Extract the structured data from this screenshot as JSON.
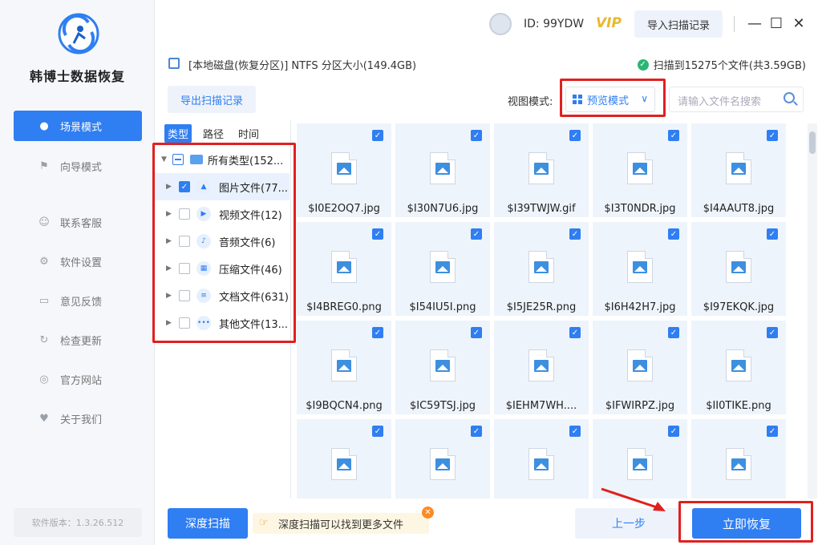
{
  "app": {
    "name": "韩博士数据恢复",
    "version_label": "软件版本：1.3.26.512"
  },
  "user": {
    "id_label": "ID: 99YDW",
    "vip_label": "VIP"
  },
  "header": {
    "import_label": "导入扫描记录",
    "window_controls": [
      "minimize-icon",
      "maximize-icon",
      "close-icon"
    ]
  },
  "sidebar": {
    "items": [
      {
        "label": "场景模式",
        "icon": "scene-icon",
        "active": true
      },
      {
        "label": "向导模式",
        "icon": "flag-icon"
      },
      {
        "label": "联系客服",
        "icon": "support-icon"
      },
      {
        "label": "软件设置",
        "icon": "gear-icon"
      },
      {
        "label": "意见反馈",
        "icon": "feedback-icon"
      },
      {
        "label": "检查更新",
        "icon": "update-icon"
      },
      {
        "label": "官方网站",
        "icon": "globe-icon"
      },
      {
        "label": "关于我们",
        "icon": "about-icon"
      }
    ]
  },
  "pathbar": {
    "path": "[本地磁盘(恢复分区)] NTFS 分区大小(149.4GB)",
    "scan_result": "扫描到15275个文件(共3.59GB)"
  },
  "toolbar": {
    "export_label": "导出扫描记录",
    "view_mode_label": "视图模式:",
    "view_mode_value": "预览模式",
    "search_placeholder": "请输入文件名搜索"
  },
  "tree": {
    "tabs": [
      "类型",
      "路径",
      "时间"
    ],
    "root": {
      "label": "所有类型(152..."
    },
    "children": [
      {
        "label": "图片文件(77...",
        "checked": true,
        "icon": "image-icon",
        "glyph": "▲"
      },
      {
        "label": "视频文件(12)",
        "checked": false,
        "icon": "video-icon",
        "glyph": "▶"
      },
      {
        "label": "音频文件(6)",
        "checked": false,
        "icon": "audio-icon",
        "glyph": "♪"
      },
      {
        "label": "压缩文件(46)",
        "checked": false,
        "icon": "archive-icon",
        "glyph": "▦"
      },
      {
        "label": "文档文件(631)",
        "checked": false,
        "icon": "document-icon",
        "glyph": "≡"
      },
      {
        "label": "其他文件(13...",
        "checked": false,
        "icon": "other-icon",
        "glyph": "•••"
      }
    ]
  },
  "files": [
    "$I0E2OQ7.jpg",
    "$I30N7U6.jpg",
    "$I39TWJW.gif",
    "$I3T0NDR.jpg",
    "$I4AAUT8.jpg",
    "$I4BREG0.png",
    "$I54IU5I.png",
    "$I5JE25R.png",
    "$I6H42H7.jpg",
    "$I97EKQK.jpg",
    "$I9BQCN4.png",
    "$IC59TSJ.jpg",
    "$IEHM7WH....",
    "$IFWIRPZ.jpg",
    "$II0TIKE.png",
    "",
    "",
    "",
    "",
    ""
  ],
  "bottom": {
    "deep_scan_label": "深度扫描",
    "tip_text": "深度扫描可以找到更多文件",
    "prev_label": "上一步",
    "recover_label": "立即恢复"
  },
  "colors": {
    "accent": "#2f7ef2",
    "highlight": "#e0201f",
    "vip": "#e8b830"
  }
}
